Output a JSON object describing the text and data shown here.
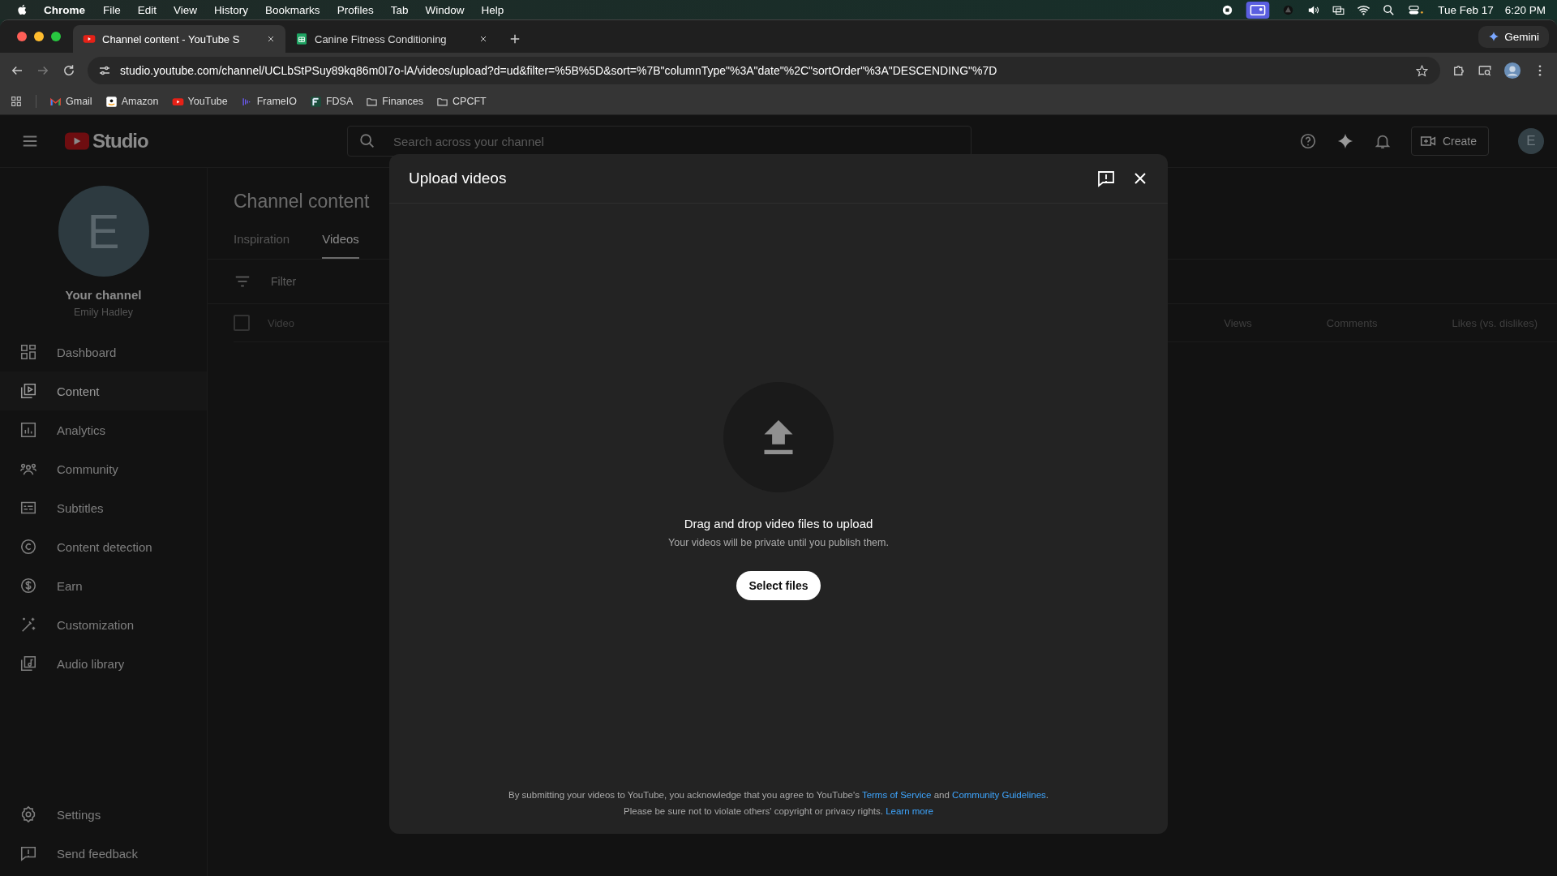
{
  "menu_bar": {
    "app": "Chrome",
    "items": [
      "File",
      "Edit",
      "View",
      "History",
      "Bookmarks",
      "Profiles",
      "Tab",
      "Window",
      "Help"
    ],
    "date": "Tue Feb 17",
    "time": "6:20 PM"
  },
  "browser": {
    "tabs": [
      {
        "title": "Channel content - YouTube S",
        "selected": true,
        "kind": "youtube"
      },
      {
        "title": "Canine Fitness Conditioning",
        "selected": false,
        "kind": "sheets"
      }
    ],
    "gemini": "Gemini",
    "url": "studio.youtube.com/channel/UCLbStPSuy89kq86m0I7o-lA/videos/upload?d=ud&filter=%5B%5D&sort=%7B\"columnType\"%3A\"date\"%2C\"sortOrder\"%3A\"DESCENDING\"%7D",
    "bookmarks": [
      {
        "label": "Gmail",
        "kind": "gmail"
      },
      {
        "label": "Amazon",
        "kind": "amazon"
      },
      {
        "label": "YouTube",
        "kind": "youtube"
      },
      {
        "label": "FrameIO",
        "kind": "frameio"
      },
      {
        "label": "FDSA",
        "kind": "fdsa"
      },
      {
        "label": "Finances",
        "kind": "folder"
      },
      {
        "label": "CPCFT",
        "kind": "folder"
      }
    ]
  },
  "studio": {
    "logo": "Studio",
    "search": {
      "placeholder": "Search across your channel"
    },
    "create": "Create",
    "avatar_letter": "E",
    "sidebar": {
      "avatar_letter": "E",
      "channel_label": "Your channel",
      "channel_name": "Emily Hadley",
      "items": [
        {
          "label": "Dashboard",
          "selected": false
        },
        {
          "label": "Content",
          "selected": true
        },
        {
          "label": "Analytics",
          "selected": false
        },
        {
          "label": "Community",
          "selected": false
        },
        {
          "label": "Subtitles",
          "selected": false
        },
        {
          "label": "Content detection",
          "selected": false
        },
        {
          "label": "Earn",
          "selected": false
        },
        {
          "label": "Customization",
          "selected": false
        },
        {
          "label": "Audio library",
          "selected": false
        }
      ],
      "footer_items": [
        {
          "label": "Settings"
        },
        {
          "label": "Send feedback"
        }
      ]
    },
    "main": {
      "title": "Channel content",
      "tabs": [
        {
          "label": "Inspiration",
          "selected": false
        },
        {
          "label": "Videos",
          "selected": true
        }
      ],
      "filter": {
        "placeholder": "Filter"
      },
      "table": {
        "select_all": {
          "checked": false
        },
        "columns_left": [
          "Video"
        ],
        "columns_right": [
          "Views",
          "Comments",
          "Likes (vs. dislikes)"
        ]
      }
    }
  },
  "dialog": {
    "title": "Upload videos",
    "drop_text": "Drag and drop video files to upload",
    "note": "Your videos will be private until you publish them.",
    "button": "Select files",
    "footer": [
      [
        {
          "text": "By submitting your videos to YouTube, you acknowledge that you agree to YouTube's ",
          "link": false
        },
        {
          "text": "Terms of Service",
          "link": true
        },
        {
          "text": " and ",
          "link": false
        },
        {
          "text": "Community Guidelines",
          "link": true
        },
        {
          "text": ".",
          "link": false
        }
      ],
      [
        {
          "text": "Please be sure not to violate others' copyright or privacy rights. ",
          "link": false
        },
        {
          "text": "Learn more",
          "link": true
        }
      ]
    ]
  }
}
